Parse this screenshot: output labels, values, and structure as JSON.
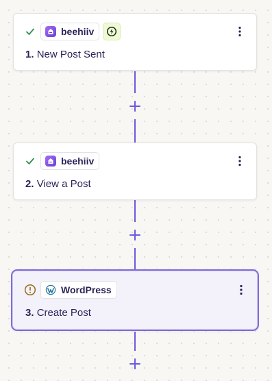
{
  "steps": [
    {
      "number": "1.",
      "title": "New Post Sent",
      "app": "beehiiv",
      "status_icon": "check-icon",
      "is_trigger": true,
      "selected": false
    },
    {
      "number": "2.",
      "title": "View a Post",
      "app": "beehiiv",
      "status_icon": "check-icon",
      "is_trigger": false,
      "selected": false
    },
    {
      "number": "3.",
      "title": "Create Post",
      "app": "WordPress",
      "status_icon": "warning-icon",
      "is_trigger": false,
      "selected": true
    }
  ],
  "colors": {
    "accent": "#6b5ae0",
    "success": "#2f8f4e",
    "warning": "#9a6a12",
    "trigger_bg": "#eefad6",
    "selected_border": "#7d6bd8"
  }
}
